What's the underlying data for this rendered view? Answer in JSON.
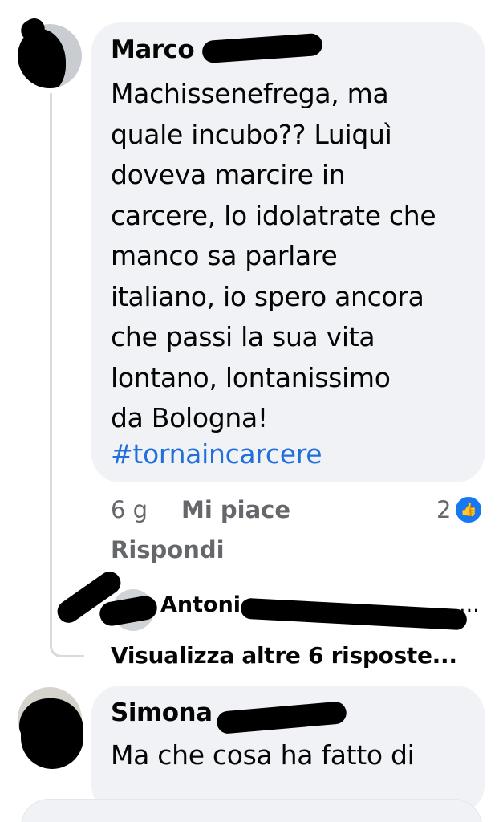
{
  "comments": [
    {
      "author": "Marco",
      "text": "Machissenefrega, ma\nquale incubo?? Luiquì\ndoveva marcire in\ncarcere, lo idolatrate che\nmanco sa parlare\nitaliano, io spero ancora\nche passi la sua  vita\nlontano, lontanissimo\nda Bologna!",
      "hashtag": "#tornaincarcere",
      "time": "6 g",
      "like_label": "Mi piace",
      "reply_label": "Rispondi",
      "reaction_count": "2",
      "reaction_icon": "like-icon",
      "reply_preview": {
        "author": "Antonio",
        "trailing_text": "..."
      },
      "more_replies_label": "Visualizza altre 6 risposte..."
    },
    {
      "author": "Simona",
      "text": "Ma che cosa ha fatto di"
    }
  ],
  "colors": {
    "bubble": "#f0f2f5",
    "hashtag": "#216fdb",
    "meta": "#65676b",
    "like_badge": "#1877f2",
    "thread_line": "#d7dade"
  }
}
